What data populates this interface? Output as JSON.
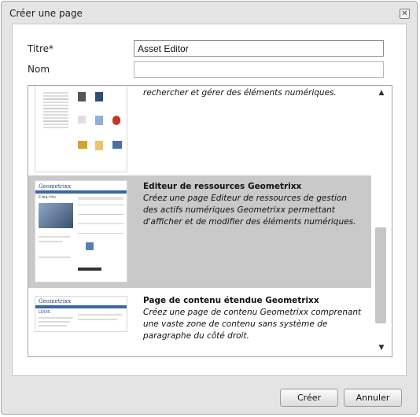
{
  "dialog": {
    "title": "Créer une page",
    "close_icon": "close-icon"
  },
  "form": {
    "title_label": "Titre*",
    "title_value": "Asset Editor",
    "name_label": "Nom",
    "name_value": ""
  },
  "templates": [
    {
      "title": "",
      "description": "rechercher et gérer des éléments numériques.",
      "selected": false
    },
    {
      "title": "Editeur de ressources Geometrixx",
      "description": "Créez une page Editeur de ressources de gestion des actifs numériques Geometrixx permettant d'afficher et de modifier des éléments numériques.",
      "selected": true,
      "thumb_brand": "Geometrixx",
      "thumb_heading": "Crea ritu"
    },
    {
      "title": "Page de contenu étendue Geometrixx",
      "description": "Créez une page de contenu Geometrixx comprenant une vaste zone de contenu sans système de paragraphe du côté droit.",
      "selected": false,
      "thumb_brand": "Geometrixx",
      "thumb_heading": "LOUIS"
    }
  ],
  "scrollbar": {
    "up_icon": "arrow-up-icon",
    "down_icon": "arrow-down-icon"
  },
  "footer": {
    "create_label": "Créer",
    "cancel_label": "Annuler"
  },
  "colors": {
    "dialog_bg": "#e4e4e4",
    "selected_bg": "#c9c9c9",
    "brand_blue": "#3b67a8"
  }
}
